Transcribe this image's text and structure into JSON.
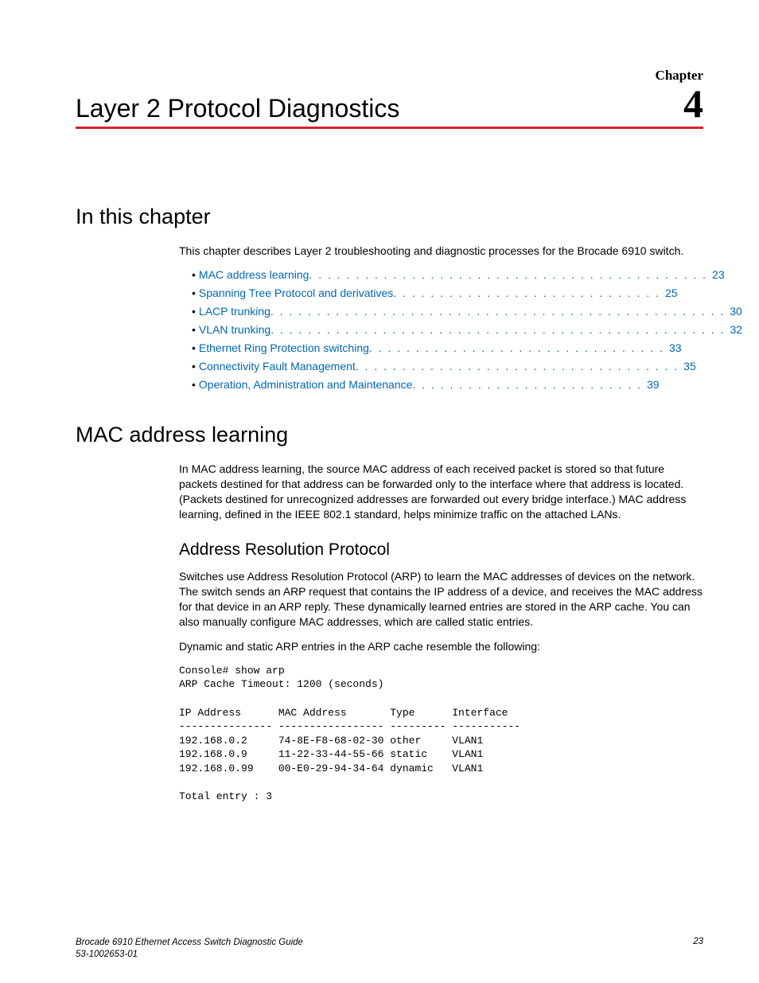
{
  "header": {
    "label": "Chapter",
    "number": "4",
    "title": "Layer 2 Protocol Diagnostics"
  },
  "section1": {
    "heading": "In this chapter",
    "intro": "This chapter describes Layer 2 troubleshooting and diagnostic processes for the Brocade 6910 switch.",
    "toc": [
      {
        "label": "MAC address learning",
        "dots": ". . . . . . . . . . . . . . . . . . . . . . . . . . . . . . . . . . . . . . . . . . .",
        "page": "23"
      },
      {
        "label": "Spanning Tree Protocol and derivatives",
        "dots": ". . . . . . . . . . . . . . . . . . . . . . . . . . . . .",
        "page": "25"
      },
      {
        "label": "LACP trunking",
        "dots": ". . . . . . . . . . . . . . . . . . . . . . . . . . . . . . . . . . . . . . . . . . . . . . . . .",
        "page": "30"
      },
      {
        "label": "VLAN trunking",
        "dots": " . . . . . . . . . . . . . . . . . . . . . . . . . . . . . . . . . . . . . . . . . . . . . . . . .",
        "page": "32"
      },
      {
        "label": "Ethernet Ring Protection switching",
        "dots": " . . . . . . . . . . . . . . . . . . . . . . . . . . . . . . . .",
        "page": "33"
      },
      {
        "label": "Connectivity Fault Management",
        "dots": ". . . . . . . . . . . . . . . . . . . . . . . . . . . . . . . . . . .",
        "page": "35"
      },
      {
        "label": "Operation, Administration and Maintenance",
        "dots": ". . . . . . . . . . . . . . . . . . . . . . . . .",
        "page": "39"
      }
    ]
  },
  "section2": {
    "heading": "MAC address learning",
    "p1": "In MAC address learning, the source MAC address of each received packet is stored so that future packets destined for that address can be forwarded only to the interface where that address is located. (Packets destined for unrecognized addresses are forwarded out every bridge interface.) MAC address learning, defined in the IEEE 802.1 standard, helps minimize traffic on the attached LANs.",
    "sub_heading": "Address Resolution Protocol",
    "p2": "Switches use Address Resolution Protocol (ARP) to learn the MAC addresses of devices on the network. The switch sends an ARP request that contains the IP address of a device, and receives the MAC address for that device in an ARP reply. These dynamically learned entries are stored in the ARP cache. You can also manually configure MAC addresses, which are called static entries.",
    "p3": "Dynamic and static ARP entries in the ARP cache resemble the following:",
    "console": "Console# show arp\nARP Cache Timeout: 1200 (seconds)\n\nIP Address      MAC Address       Type      Interface\n--------------- ----------------- --------- -----------\n192.168.0.2     74-8E-F8-68-02-30 other     VLAN1\n192.168.0.9     11-22-33-44-55-66 static    VLAN1\n192.168.0.99    00-E0-29-94-34-64 dynamic   VLAN1\n\nTotal entry : 3"
  },
  "footer": {
    "line1": "Brocade 6910 Ethernet Access Switch Diagnostic Guide",
    "line2": "53-1002653-01",
    "page": "23"
  }
}
